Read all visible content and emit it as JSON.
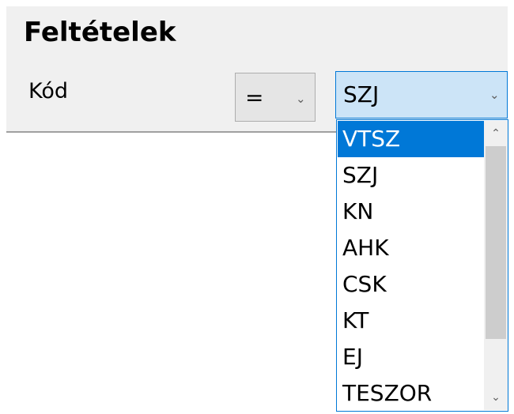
{
  "section": {
    "title": "Feltételek"
  },
  "condition": {
    "field_label": "Kód",
    "operator": {
      "value": "="
    },
    "code": {
      "value": "SZJ"
    }
  },
  "dropdown": {
    "options": [
      "VTSZ",
      "SZJ",
      "KN",
      "AHK",
      "CSK",
      "KT",
      "EJ",
      "TESZOR"
    ],
    "highlighted": "VTSZ"
  },
  "icons": {
    "combo_arrow": "chevron-down-icon",
    "scroll_up": "scroll-up-icon",
    "scroll_down": "scroll-down-icon"
  },
  "colors": {
    "selection": "#0078d7",
    "combo_focus_bg": "#cce4f7",
    "panel_bg": "#f0f0f0"
  }
}
